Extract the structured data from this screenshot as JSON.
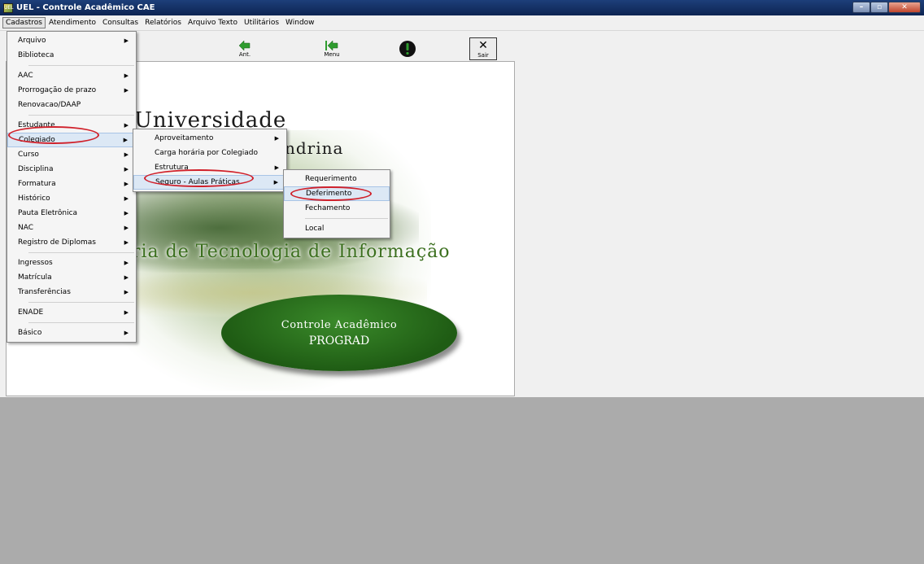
{
  "window": {
    "title": "UEL - Controle Acadêmico CAE",
    "icon_label": "UEL"
  },
  "menubar": [
    "Cadastros",
    "Atendimento",
    "Consultas",
    "Relatórios",
    "Arquivo Texto",
    "Utilitários",
    "Window"
  ],
  "toolbar": {
    "ant_label": "Ant.",
    "menu_label": "Menu",
    "sair_label": "Sair"
  },
  "splash": {
    "line1": "Universidade",
    "line2": "ndrina",
    "line3": "ria de Tecnologia de Informação",
    "oval_line1": "Controle Acadêmico",
    "oval_line2": "PROGRAD"
  },
  "menus": {
    "cadastros": [
      "Arquivo",
      "Biblioteca",
      "AAC",
      "Prorrogação de prazo",
      "Renovacao/DAAP",
      "Estudante",
      "Colegiado",
      "Curso",
      "Disciplina",
      "Formatura",
      "Histórico",
      "Pauta Eletrônica",
      "NAC",
      "Registro de Diplomas",
      "Ingressos",
      "Matrícula",
      "Transferências",
      "ENADE",
      "Básico"
    ],
    "colegiado": [
      "Aproveitamento",
      "Carga horária por Colegiado",
      "Estrutura",
      "Seguro - Aulas Práticas"
    ],
    "seguro": [
      "Requerimento",
      "Deferimento",
      "Fechamento",
      "Local"
    ]
  },
  "colors": {
    "titlebar": "#0d2452",
    "accent_green": "#3b6f1e",
    "annotation_red": "#d0202a",
    "workspace_gray": "#ababab"
  }
}
